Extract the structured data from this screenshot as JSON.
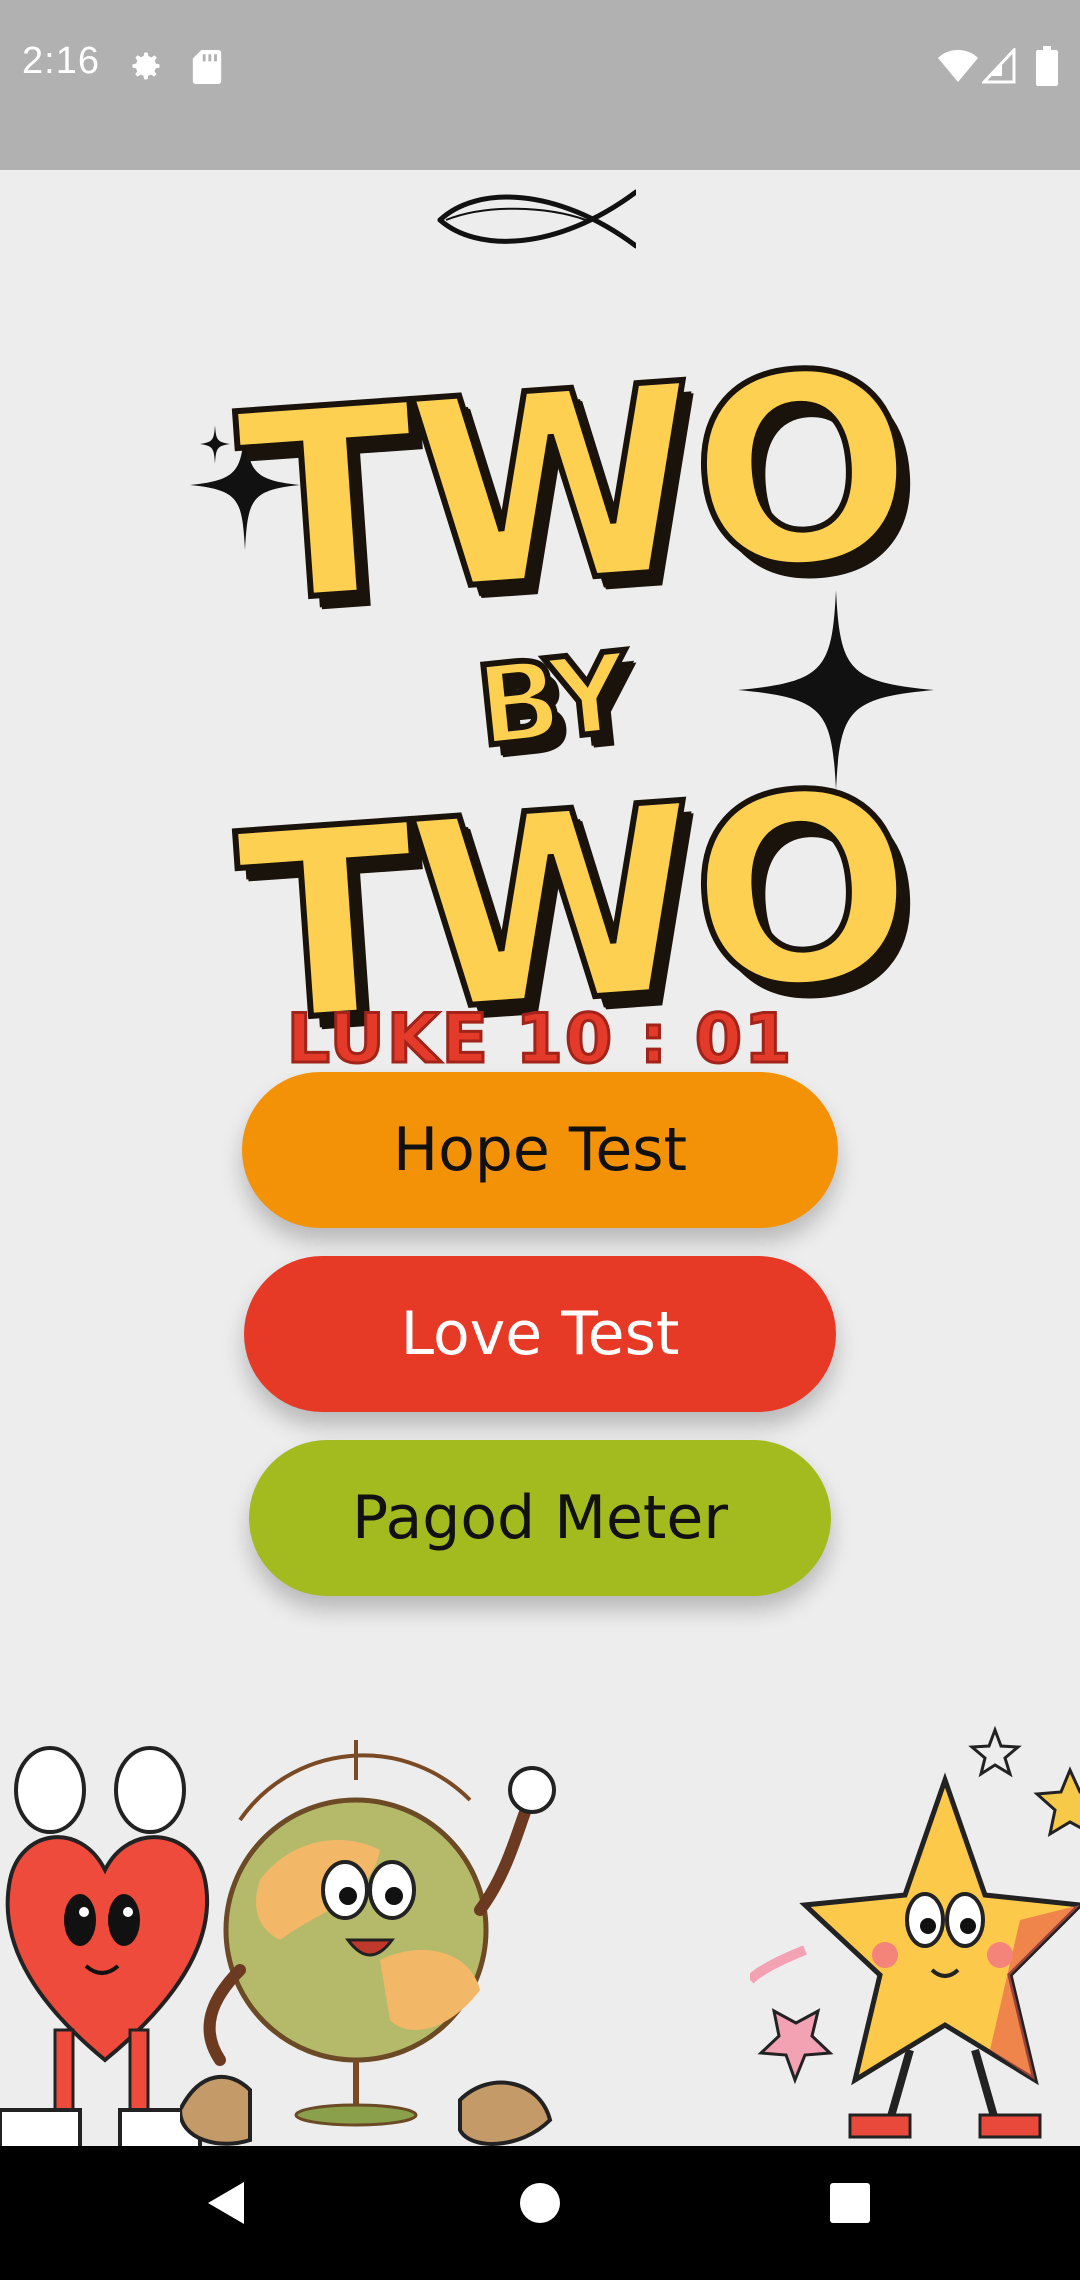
{
  "status_bar": {
    "time": "2:16",
    "icons": [
      "gear-icon",
      "sd-card-icon",
      "wifi-icon",
      "cellular-signal-icon",
      "battery-icon"
    ]
  },
  "header": {
    "logo_icon": "ichthys-fish-icon"
  },
  "title": {
    "line1": "TWO",
    "line2": "BY",
    "line3": "TWO"
  },
  "verse": "LUKE 10 : 01",
  "buttons": {
    "hope": "Hope Test",
    "love": "Love Test",
    "pagod": "Pagod Meter"
  },
  "colors": {
    "background": "#ededed",
    "status_bar": "#b1b1b1",
    "title_fill": "#fdd052",
    "verse": "#e33a29",
    "hope_button": "#f39207",
    "love_button": "#e63a27",
    "pagod_button": "#a3bb1f"
  },
  "illustrations": [
    "heart-mascot",
    "globe-mascot",
    "star-mascot"
  ],
  "nav_bar": {
    "icons": [
      "back-icon",
      "home-icon",
      "recents-icon"
    ]
  }
}
